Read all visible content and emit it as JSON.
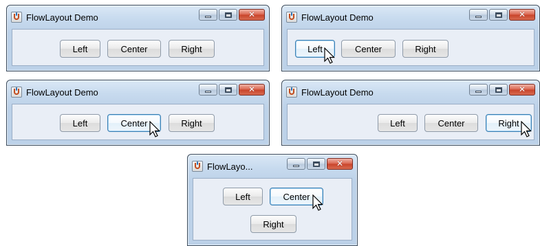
{
  "windows": [
    {
      "title": "FlowLayout Demo",
      "buttons": {
        "left": "Left",
        "center": "Center",
        "right": "Right"
      },
      "hovered": null
    },
    {
      "title": "FlowLayout Demo",
      "buttons": {
        "left": "Left",
        "center": "Center",
        "right": "Right"
      },
      "hovered": "left"
    },
    {
      "title": "FlowLayout Demo",
      "buttons": {
        "left": "Left",
        "center": "Center",
        "right": "Right"
      },
      "hovered": "center"
    },
    {
      "title": "FlowLayout Demo",
      "buttons": {
        "left": "Left",
        "center": "Center",
        "right": "Right"
      },
      "hovered": "right"
    },
    {
      "title": "FlowLayo...",
      "buttons": {
        "left": "Left",
        "center": "Center",
        "right": "Right"
      },
      "hovered": "center"
    }
  ],
  "icons": {
    "app": "java-coffee-cup-icon",
    "minimize": "minimize-icon",
    "maximize": "maximize-icon",
    "close": "close-icon",
    "cursor": "mouse-pointer-icon"
  }
}
